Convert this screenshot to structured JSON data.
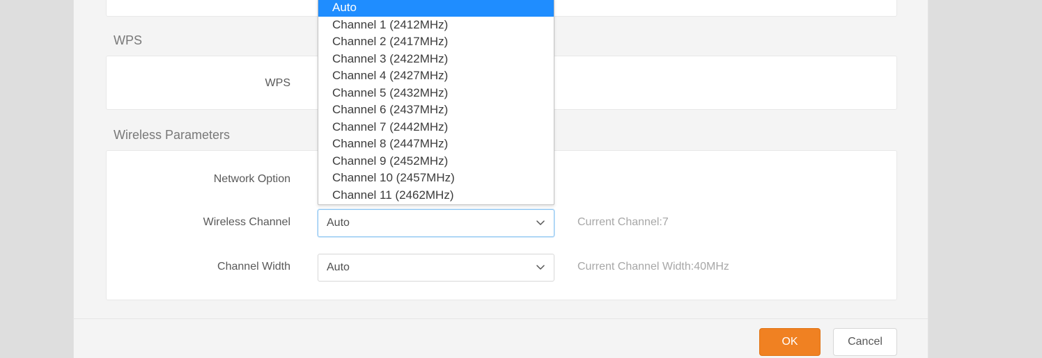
{
  "sections": {
    "wps_title": "WPS",
    "wireless_params_title": "Wireless Parameters"
  },
  "wps": {
    "label": "WPS"
  },
  "params": {
    "network_option_label": "Network Option",
    "wireless_channel_label": "Wireless Channel",
    "channel_width_label": "Channel Width",
    "wireless_channel_value": "Auto",
    "channel_width_value": "Auto",
    "current_channel_hint": "Current Channel:7",
    "current_width_hint": "Current Channel Width:40MHz"
  },
  "channel_options": [
    "Auto",
    "Channel 1 (2412MHz)",
    "Channel 2 (2417MHz)",
    "Channel 3 (2422MHz)",
    "Channel 4 (2427MHz)",
    "Channel 5 (2432MHz)",
    "Channel 6 (2437MHz)",
    "Channel 7 (2442MHz)",
    "Channel 8 (2447MHz)",
    "Channel 9 (2452MHz)",
    "Channel 10 (2457MHz)",
    "Channel 11 (2462MHz)"
  ],
  "channel_selected_index": 0,
  "footer": {
    "ok": "OK",
    "cancel": "Cancel"
  }
}
